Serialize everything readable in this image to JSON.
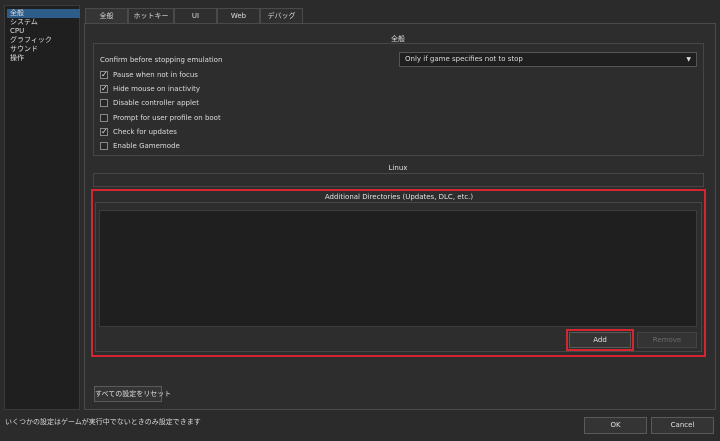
{
  "sidebar": {
    "items": [
      "全般",
      "システム",
      "CPU",
      "グラフィック",
      "サウンド",
      "操作"
    ]
  },
  "tabs": [
    "全般",
    "ホットキー",
    "UI",
    "Web",
    "デバッグ"
  ],
  "general": {
    "section_title": "全般",
    "confirm_stop_label": "Confirm before stopping emulation",
    "confirm_stop_value": "Only if game specifies not to stop",
    "checkboxes": [
      {
        "label": "Pause when not in focus",
        "checked": "✓"
      },
      {
        "label": "Hide mouse on inactivity",
        "checked": "✓"
      },
      {
        "label": "Disable controller applet",
        "checked": ""
      },
      {
        "label": "Prompt for user profile on boot",
        "checked": ""
      },
      {
        "label": "Check for updates",
        "checked": "✓"
      },
      {
        "label": "Enable Gamemode",
        "checked": ""
      }
    ]
  },
  "linux": {
    "section_title": "Linux"
  },
  "directories": {
    "section_title": "Additional Directories (Updates, DLC, etc.)",
    "add_label": "Add",
    "remove_label": "Remove"
  },
  "reset_label": "すべての設定をリセット",
  "status_text": "いくつかの設定はゲームが実行中でないときのみ設定できます",
  "footer": {
    "ok_label": "OK",
    "cancel_label": "Cancel"
  },
  "colors": {
    "highlight": "#d3262f",
    "selected": "#2f5d8a",
    "background": "#2b2b2b"
  }
}
